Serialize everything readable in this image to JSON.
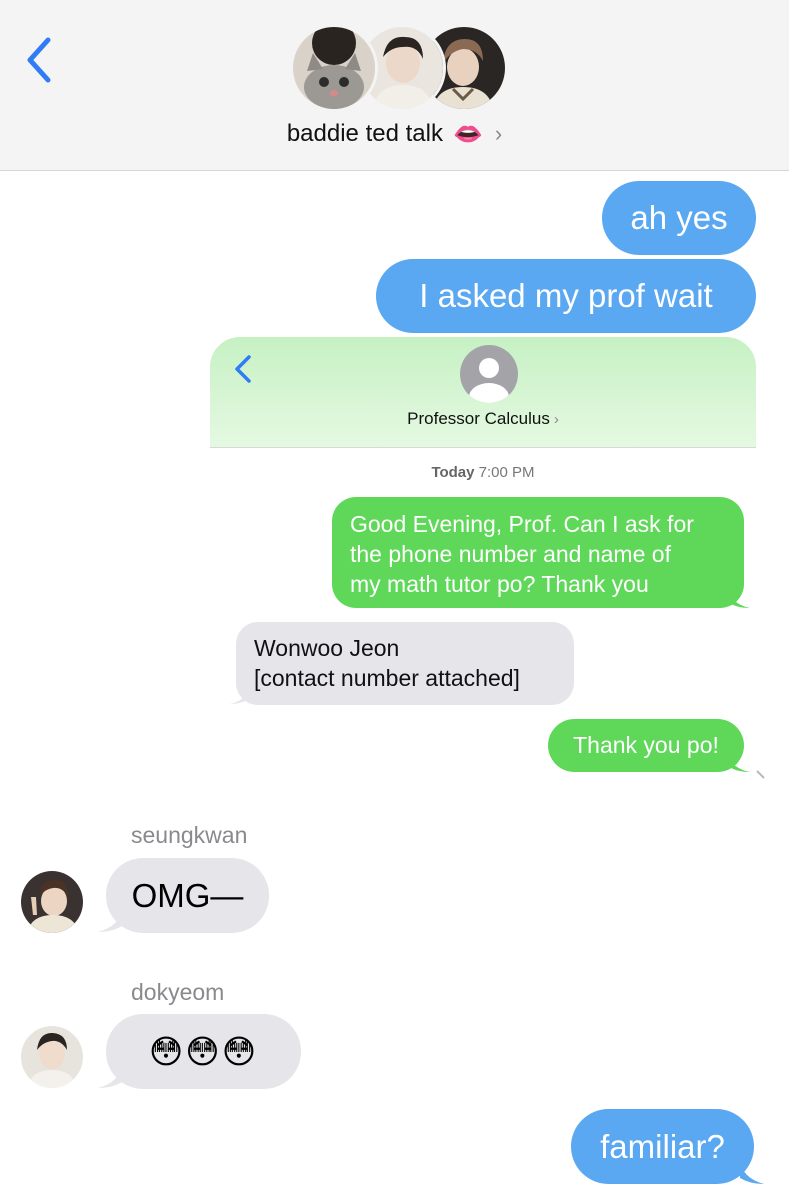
{
  "header": {
    "title": "baddie ted talk",
    "title_emoji": "👄",
    "chevron": "›",
    "back_icon": "chevron-left-icon"
  },
  "messages": {
    "m1": "ah yes",
    "m2": "I asked my prof wait",
    "m_seungkwan_name": "seungkwan",
    "m_seungkwan": "OMG—",
    "m_dokyeom_name": "dokyeom",
    "m_dokyeom": "😳😳😳",
    "m_last": "familiar?"
  },
  "embedded": {
    "contact_name": "Professor Calculus",
    "chevron": "›",
    "timestamp_day": "Today",
    "timestamp_time": "7:00 PM",
    "sent1_line1": "Good Evening, Prof. Can I ask for",
    "sent1_line2": "the phone number and name of",
    "sent1_line3": "my math tutor po? Thank you",
    "recv1_line1": "Wonwoo Jeon",
    "recv1_line2": "[contact number attached]",
    "sent2": "Thank you po!"
  },
  "colors": {
    "blue_bubble": "#5aa7f2",
    "green_bubble": "#5fd85a",
    "grey_bubble": "#e6e6ea",
    "ios_blue": "#2f7cf6"
  }
}
